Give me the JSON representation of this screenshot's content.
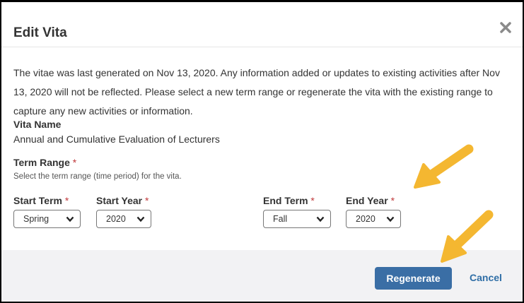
{
  "dialog": {
    "title": "Edit Vita",
    "notice": "The vitae was last generated on Nov 13, 2020. Any information added or updates to existing activities after Nov 13, 2020 will not be reflected. Please select a new term range or regenerate the vita with the existing range to capture any new activities or information.",
    "vita_name_label": "Vita Name",
    "vita_name_value": "Annual and Cumulative Evaluation of Lecturers",
    "term_range_label": "Term Range",
    "required_marker": "*",
    "term_range_help": "Select the term range (time period) for the vita.",
    "start_term": {
      "label": "Start Term",
      "value": "Spring"
    },
    "start_year": {
      "label": "Start Year",
      "value": "2020"
    },
    "end_term": {
      "label": "End Term",
      "value": "Fall"
    },
    "end_year": {
      "label": "End Year",
      "value": "2020"
    },
    "regenerate_label": "Regenerate",
    "cancel_label": "Cancel"
  },
  "icons": {
    "close": "close-icon",
    "chevron": "chevron-down-icon",
    "annotation": "arrow-annotation"
  },
  "colors": {
    "primary": "#3a6ea5",
    "link": "#2f6ea6",
    "required": "#c0393b",
    "arrow": "#f4b731",
    "footer_bg": "#f2f2f4"
  }
}
